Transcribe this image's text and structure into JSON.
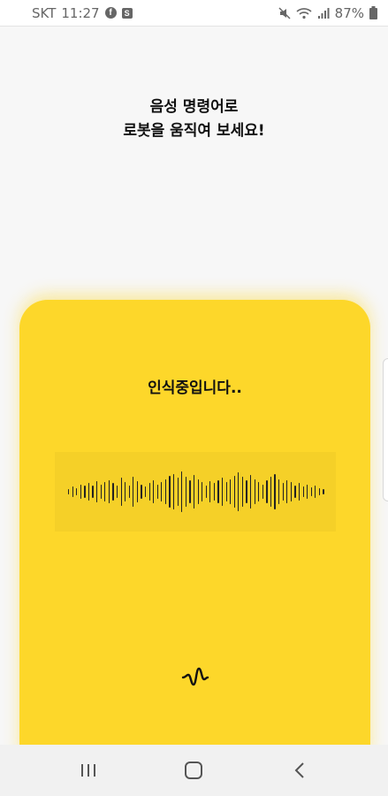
{
  "status_bar": {
    "carrier": "SKT",
    "time": "11:27",
    "facebook_icon": "facebook-icon",
    "app_icon": "s-app-icon",
    "battery": "87%"
  },
  "prompt": {
    "line1": "음성 명령어로",
    "line2": "로봇을 움직여 보세요!"
  },
  "card": {
    "background": "#fdd72a",
    "status_text": "인식중입니다..",
    "waveform_levels": [
      0.12,
      0.25,
      0.18,
      0.35,
      0.28,
      0.4,
      0.3,
      0.5,
      0.35,
      0.45,
      0.55,
      0.4,
      0.3,
      0.65,
      0.45,
      0.3,
      0.7,
      0.5,
      0.35,
      0.25,
      0.4,
      0.55,
      0.35,
      0.45,
      0.6,
      0.75,
      0.85,
      0.65,
      0.95,
      0.7,
      0.55,
      0.8,
      0.6,
      0.45,
      0.3,
      0.5,
      0.4,
      0.55,
      0.65,
      0.45,
      0.6,
      0.75,
      0.9,
      0.7,
      0.55,
      0.8,
      0.6,
      0.45,
      0.35,
      0.55,
      0.7,
      0.85,
      0.6,
      0.4,
      0.55,
      0.45,
      0.3,
      0.4,
      0.25,
      0.35,
      0.2,
      0.3,
      0.18,
      0.12
    ],
    "mic_icon": "voice-wave-icon"
  },
  "nav_bar": {
    "recent_icon": "recent-apps-icon",
    "home_icon": "home-icon",
    "back_icon": "back-icon"
  }
}
